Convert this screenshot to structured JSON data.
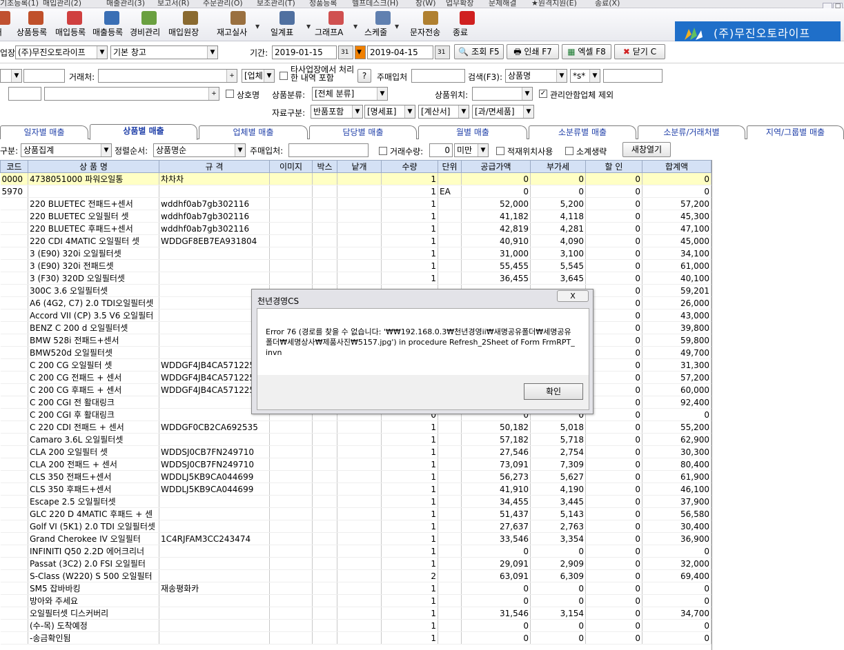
{
  "menubar": [
    "기초등록(1)",
    "매입관리(2)",
    "매출관리(3)",
    "보고서(R)",
    "주문관리(O)",
    "보조관리(T)",
    "정품등록",
    "헬프데스크(H)",
    "창(W)",
    "업무확장",
    "문제해결",
    "★원격지원(E)",
    "종료(X)"
  ],
  "window_buttons": [
    "_",
    "□"
  ],
  "toolbar": {
    "items": [
      {
        "label": "처",
        "icon": "partial-icon",
        "color": "#c05030"
      },
      {
        "label": "상품등록",
        "icon": "box-icon",
        "color": "#c0502a"
      },
      {
        "label": "매입등록",
        "icon": "purchase-icon",
        "color": "#d04040"
      },
      {
        "label": "매출등록",
        "icon": "sales-icon",
        "color": "#3a6fb5"
      },
      {
        "label": "경비관리",
        "icon": "expense-icon",
        "color": "#6aa040"
      },
      {
        "label": "매입원장",
        "icon": "ledger-icon",
        "color": "#8a6a30"
      },
      {
        "label": "재고실사",
        "icon": "inventory-icon",
        "color": "#9a7040"
      },
      {
        "label": "일계표",
        "icon": "daily-report-icon",
        "color": "#5070a0"
      },
      {
        "label": "그래프A",
        "icon": "graph-icon",
        "color": "#d05050"
      },
      {
        "label": "스케줄",
        "icon": "calendar-icon",
        "color": "#6080b0"
      },
      {
        "label": "문자전송",
        "icon": "sms-icon",
        "color": "#b08030"
      },
      {
        "label": "종료",
        "icon": "close-icon",
        "color": "#d02020"
      }
    ],
    "brand": "(주)무진오토라이프"
  },
  "filters": {
    "store_label": "업장:",
    "store_value": "(주)무진오토라이프",
    "warehouse_value": "기본 창고",
    "period_label": "기간:",
    "date_from": "2019-01-15",
    "date_to": "2019-04-15",
    "btn_search": "조회 F5",
    "btn_print": "인쇄 F7",
    "btn_excel": "엑셀 F8",
    "btn_close": "닫기 C",
    "partner_label": "거래처:",
    "biz_type": "[업체",
    "include_label": "타사업장에서 처리한 내역 포함",
    "q": "?",
    "main_partner_label": "주매입처",
    "search_label": "검색(F3):",
    "search_field": "상품명",
    "wildcard": "*s*",
    "product_label": "상호명",
    "cat_label": "상품분류:",
    "cat_value": "[전체 분류]",
    "location_label": "상품위치:",
    "exclude_label": "관리안함업체 제외",
    "data_label": "자료구분:",
    "data_return": "반품포함",
    "data_stmt": "[명세표]",
    "data_calc": "[계산서]",
    "data_tax": "[과/면세품]"
  },
  "tabs": [
    "일자별 매출",
    "상품별 매출",
    "업체별 매출",
    "담당별 매출",
    "월별 매출",
    "소분류별 매출",
    "소분류/거래처별",
    "지역/그룹별 매출"
  ],
  "options": {
    "group_label": "구분:",
    "group_value": "상품집계",
    "sort_label": "정렬순서:",
    "sort_value": "상품명순",
    "main_label": "주매입처:",
    "qty_label": "거래수량:",
    "qty_value": "0",
    "qty_cond": "미만",
    "stock_label": "적재위치사용",
    "subtotal_label": "소계생략",
    "new_window": "새창열기"
  },
  "table": {
    "headers": [
      "코드",
      "상 품 명",
      "규 격",
      "이미지",
      "박스",
      "낱개",
      "수량",
      "단위",
      "공급가액",
      "부가세",
      "할 인",
      "합계액"
    ],
    "rows": [
      [
        "0000",
        "4738051000 파워오일통",
        "차차차",
        "",
        "",
        "",
        "1",
        "",
        "0",
        "0",
        "0",
        "0"
      ],
      [
        "5970",
        "",
        "",
        "",
        "",
        "",
        "1",
        "EA",
        "0",
        "0",
        "0",
        "0"
      ],
      [
        "",
        "220 BLUETEC 전패드+센서",
        "wddhf0ab7gb302116",
        "",
        "",
        "",
        "1",
        "",
        "52,000",
        "5,200",
        "0",
        "57,200"
      ],
      [
        "",
        "220 BLUETEC 오일필터 셋",
        "wddhf0ab7gb302116",
        "",
        "",
        "",
        "1",
        "",
        "41,182",
        "4,118",
        "0",
        "45,300"
      ],
      [
        "",
        "220 BLUETEC 후패드+센서",
        "wddhf0ab7gb302116",
        "",
        "",
        "",
        "1",
        "",
        "42,819",
        "4,281",
        "0",
        "47,100"
      ],
      [
        "",
        "220 CDI 4MATIC 오일필터 셋",
        "WDDGF8EB7EA931804",
        "",
        "",
        "",
        "1",
        "",
        "40,910",
        "4,090",
        "0",
        "45,000"
      ],
      [
        "",
        "3 (E90) 320i 오일필터셋",
        "",
        "",
        "",
        "",
        "1",
        "",
        "31,000",
        "3,100",
        "0",
        "34,100"
      ],
      [
        "",
        "3 (E90) 320i 전패드셋",
        "",
        "",
        "",
        "",
        "1",
        "",
        "55,455",
        "5,545",
        "0",
        "61,000"
      ],
      [
        "",
        "3 (F30) 320D 오일필터셋",
        "",
        "",
        "",
        "",
        "1",
        "",
        "36,455",
        "3,645",
        "0",
        "40,100"
      ],
      [
        "",
        "300C 3.6 오일필터셋",
        "",
        "",
        "",
        "",
        "",
        "",
        "",
        "",
        "0",
        "59,201"
      ],
      [
        "",
        "A6 (4G2, C7) 2.0 TDI오일필터셋",
        "",
        "",
        "",
        "",
        "",
        "",
        "",
        "",
        "0",
        "26,000"
      ],
      [
        "",
        "Accord VII (CP) 3.5 V6 오일필터",
        "",
        "",
        "",
        "",
        "",
        "",
        "",
        "",
        "0",
        "43,000"
      ],
      [
        "",
        "BENZ C 200 d 오일필터셋",
        "",
        "",
        "",
        "",
        "",
        "",
        "",
        "",
        "0",
        "39,800"
      ],
      [
        "",
        "BMW 528i 전패드+센서",
        "",
        "",
        "",
        "",
        "",
        "",
        "",
        "",
        "0",
        "59,800"
      ],
      [
        "",
        "BMW520d 오일필터셋",
        "",
        "",
        "",
        "",
        "",
        "",
        "",
        "",
        "0",
        "49,700"
      ],
      [
        "",
        "C 200 CG  오일필터 셋",
        "WDDGF4JB4CA571225",
        "",
        "",
        "",
        "",
        "",
        "",
        "",
        "0",
        "31,300"
      ],
      [
        "",
        "C 200 CG 전패드 + 센서",
        "WDDGF4JB4CA571225",
        "",
        "",
        "",
        "",
        "",
        "",
        "",
        "0",
        "57,200"
      ],
      [
        "",
        "C 200 CG 후패드 + 센서",
        "WDDGF4JB4CA571225",
        "",
        "",
        "",
        "",
        "",
        "",
        "",
        "0",
        "60,000"
      ],
      [
        "",
        "C 200 CGI  전 활대링크",
        "",
        "",
        "",
        "",
        "",
        "",
        "",
        "",
        "0",
        "92,400"
      ],
      [
        "",
        "C 200 CGI  후 활대링크",
        "",
        "",
        "",
        "",
        "0",
        "",
        "0",
        "0",
        "0",
        "0"
      ],
      [
        "",
        "C 220 CDI  전패드 + 센서",
        "WDDGF0CB2CA692535",
        "",
        "",
        "",
        "1",
        "",
        "50,182",
        "5,018",
        "0",
        "55,200"
      ],
      [
        "",
        "Camaro 3.6L 오일필터셋",
        "",
        "",
        "",
        "",
        "1",
        "",
        "57,182",
        "5,718",
        "0",
        "62,900"
      ],
      [
        "",
        "CLA 200 오일필터 셋",
        "WDDSJ0CB7FN249710",
        "",
        "",
        "",
        "1",
        "",
        "27,546",
        "2,754",
        "0",
        "30,300"
      ],
      [
        "",
        "CLA 200 전패드 + 센서",
        "WDDSJ0CB7FN249710",
        "",
        "",
        "",
        "1",
        "",
        "73,091",
        "7,309",
        "0",
        "80,400"
      ],
      [
        "",
        "CLS 350 전패드+센서",
        "WDDLJ5KB9CA044699",
        "",
        "",
        "",
        "1",
        "",
        "56,273",
        "5,627",
        "0",
        "61,900"
      ],
      [
        "",
        "CLS 350 후패드+센서",
        "WDDLJ5KB9CA044699",
        "",
        "",
        "",
        "1",
        "",
        "41,910",
        "4,190",
        "0",
        "46,100"
      ],
      [
        "",
        "Escape 2.5 오일필터셋",
        "",
        "",
        "",
        "",
        "1",
        "",
        "34,455",
        "3,445",
        "0",
        "37,900"
      ],
      [
        "",
        "GLC 220 D 4MATIC 후패드 + 센",
        "",
        "",
        "",
        "",
        "1",
        "",
        "51,437",
        "5,143",
        "0",
        "56,580"
      ],
      [
        "",
        "Golf VI (5K1) 2.0 TDI 오일필터셋",
        "",
        "",
        "",
        "",
        "1",
        "",
        "27,637",
        "2,763",
        "0",
        "30,400"
      ],
      [
        "",
        "Grand Cherokee IV  오일필터",
        "1C4RJFAM3CC243474",
        "",
        "",
        "",
        "1",
        "",
        "33,546",
        "3,354",
        "0",
        "36,900"
      ],
      [
        "",
        "INFINITI Q50 2.2D 에어크리너",
        "",
        "",
        "",
        "",
        "1",
        "",
        "0",
        "0",
        "0",
        "0"
      ],
      [
        "",
        "Passat (3C2) 2.0 FSI 오일필터",
        "",
        "",
        "",
        "",
        "1",
        "",
        "29,091",
        "2,909",
        "0",
        "32,000"
      ],
      [
        "",
        "S-Class (W220) S 500 오일필터",
        "",
        "",
        "",
        "",
        "2",
        "",
        "63,091",
        "6,309",
        "0",
        "69,400"
      ],
      [
        "",
        "SM5 잡바바킹",
        "재송평화카",
        "",
        "",
        "",
        "1",
        "",
        "0",
        "0",
        "0",
        "0"
      ],
      [
        "",
        "방아와 주세요",
        "",
        "",
        "",
        "",
        "1",
        "",
        "0",
        "0",
        "0",
        "0"
      ],
      [
        "",
        "오일필터셋 디스커버리",
        "",
        "",
        "",
        "",
        "1",
        "",
        "31,546",
        "3,154",
        "0",
        "34,700"
      ],
      [
        "",
        "(수-목) 도착예정",
        "",
        "",
        "",
        "",
        "1",
        "",
        "0",
        "0",
        "0",
        "0"
      ],
      [
        "",
        "-송금확인됨",
        "",
        "",
        "",
        "",
        "1",
        "",
        "0",
        "0",
        "0",
        "0"
      ]
    ]
  },
  "dialog": {
    "title": "천년경영CS",
    "close": "X",
    "message": "Error 76 (경로를 찾을 수 없습니다: '₩₩192.168.0.3₩천년경영ii₩새명공유폴더₩세명공유폴더₩세명상사₩제품사진₩5157.jpg') in procedure Refresh_2Sheet of Form FrmRPT_invn",
    "ok": "확인"
  }
}
